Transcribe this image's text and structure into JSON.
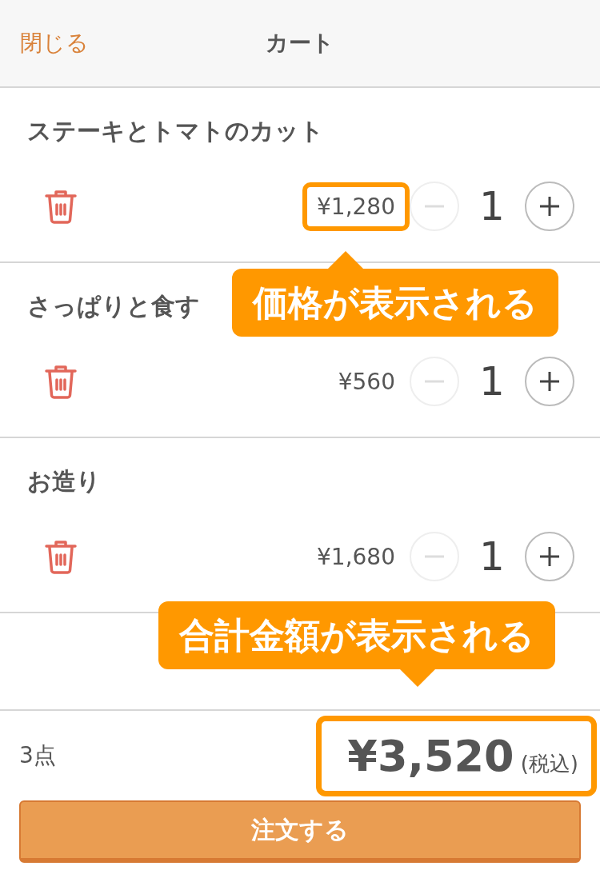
{
  "header": {
    "close": "閉じる",
    "title": "カート"
  },
  "items": [
    {
      "name": "ステーキとトマトのカット",
      "price": "¥1,280",
      "quantity": "1",
      "decrement_disabled": true,
      "highlighted": true
    },
    {
      "name": "さっぱりと食す",
      "price": "¥560",
      "quantity": "1",
      "decrement_disabled": true,
      "highlighted": false
    },
    {
      "name": "お造り",
      "price": "¥1,680",
      "quantity": "1",
      "decrement_disabled": true,
      "highlighted": false
    }
  ],
  "footer": {
    "count": "3点",
    "total": "¥3,520",
    "tax_note": "(税込)",
    "highlighted": true,
    "order_button": "注文する"
  },
  "callouts": [
    {
      "text": "価格が表示される",
      "kind": "below"
    },
    {
      "text": "合計金額が表示される",
      "kind": "above"
    }
  ]
}
